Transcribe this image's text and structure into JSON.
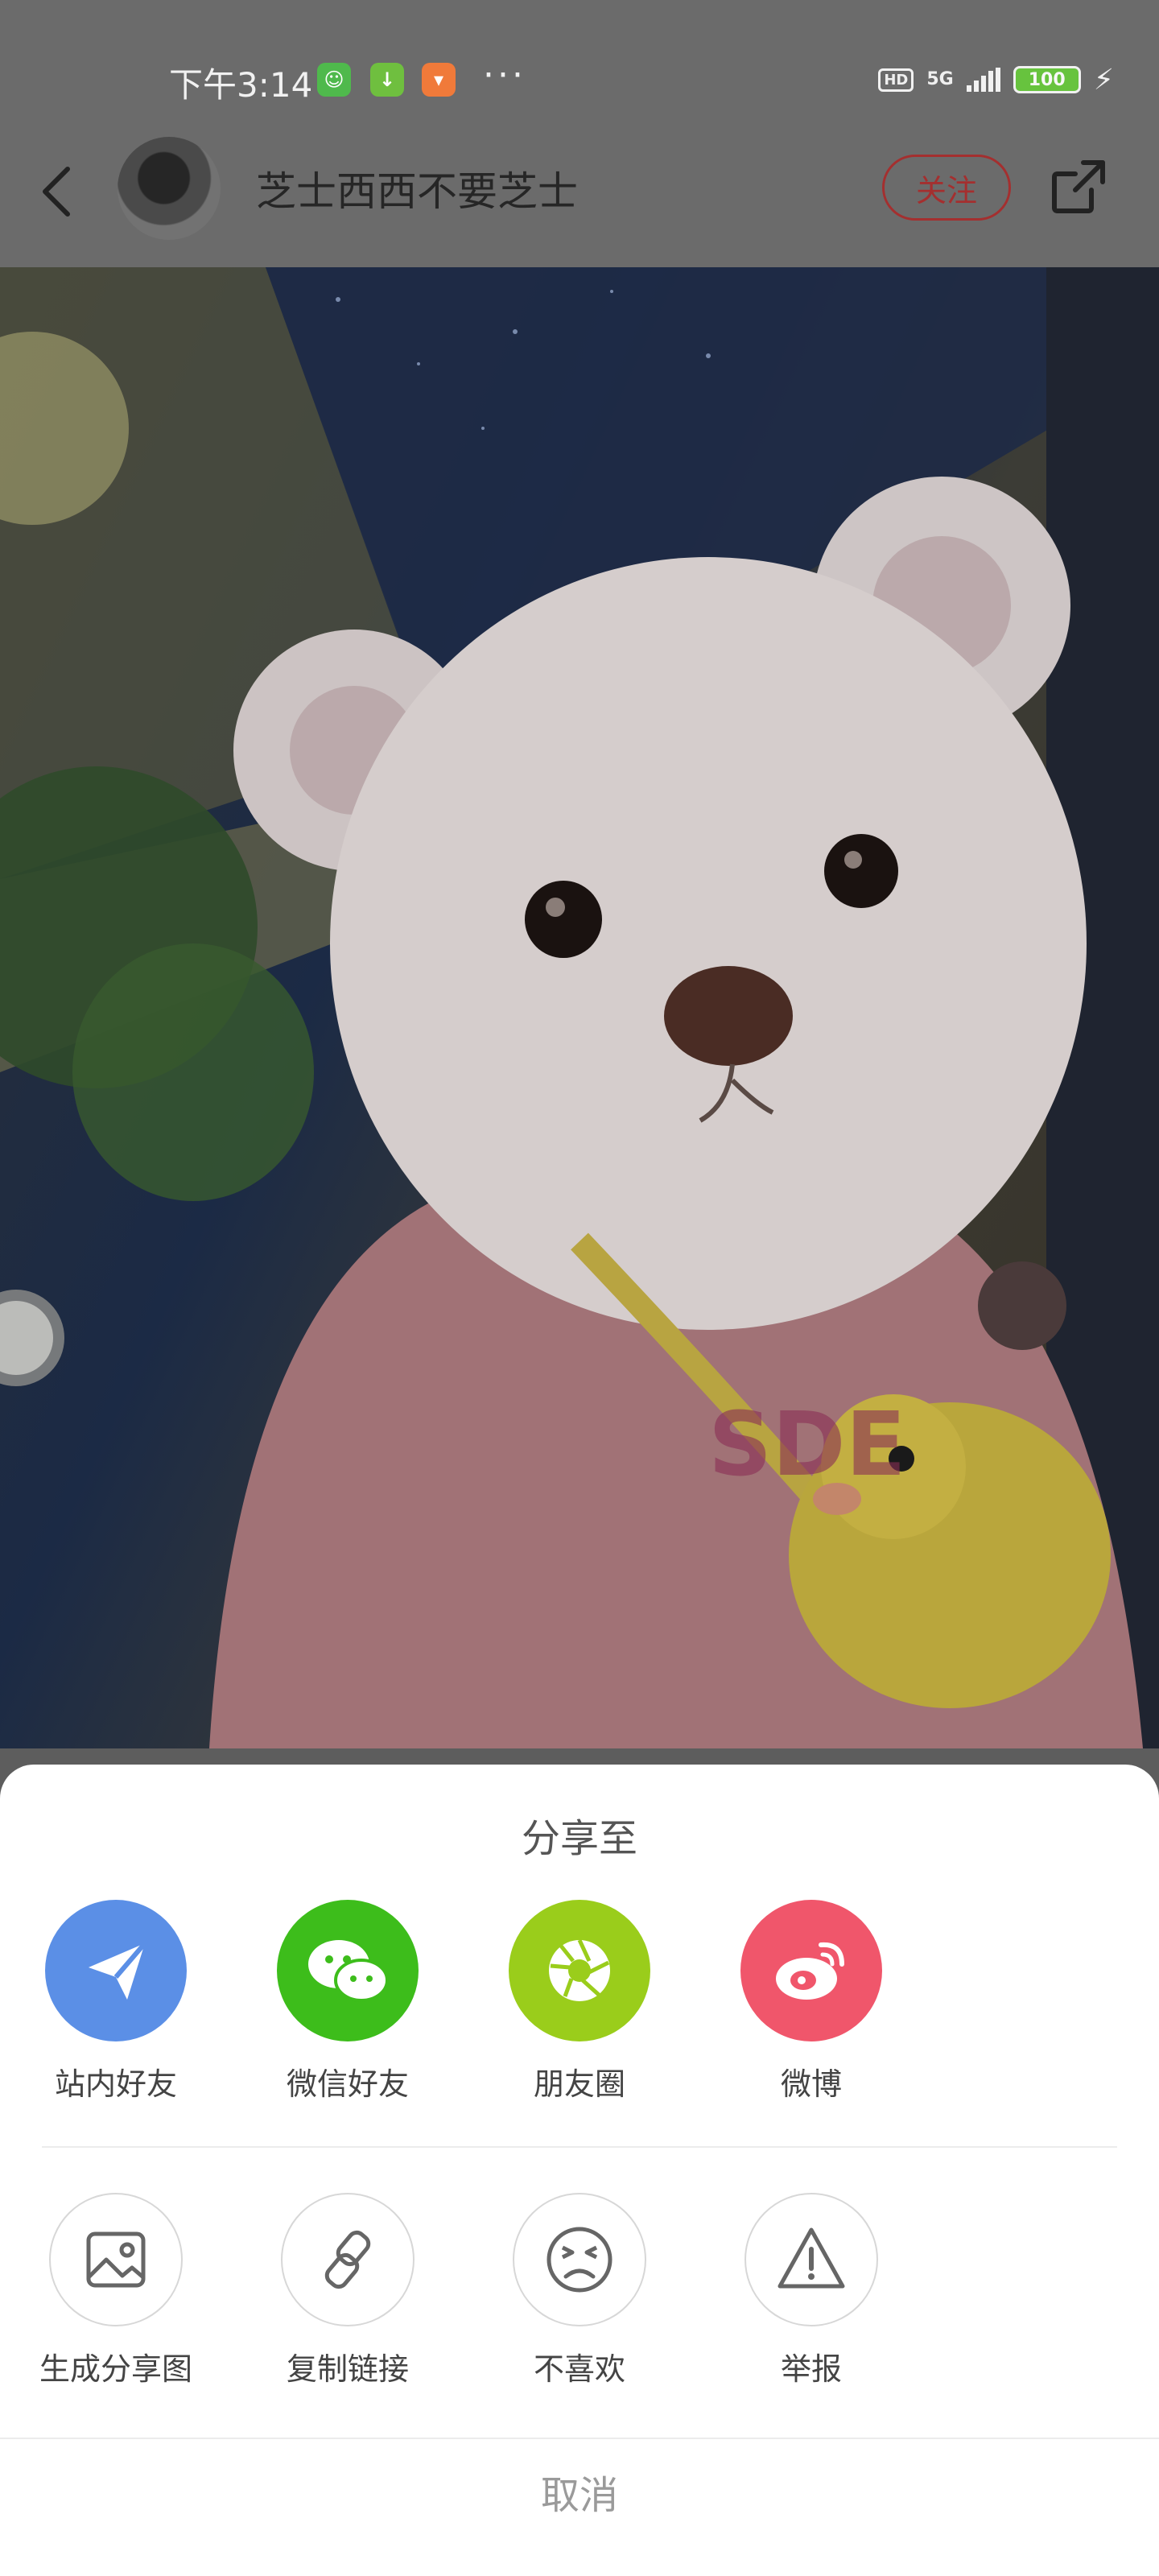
{
  "status_bar": {
    "time": "下午3:14",
    "hd": "HD",
    "network": "5G",
    "battery": "100",
    "more": "···"
  },
  "header": {
    "username": "芝士西西不要芝士",
    "follow_label": "关注"
  },
  "share_sheet": {
    "title": "分享至",
    "targets": [
      {
        "label": "站内好友",
        "icon": "paper-plane-icon",
        "color": "#5b8fe6"
      },
      {
        "label": "微信好友",
        "icon": "wechat-icon",
        "color": "#3dbd1b"
      },
      {
        "label": "朋友圈",
        "icon": "moments-icon",
        "color": "#9acd1b"
      },
      {
        "label": "微博",
        "icon": "weibo-icon",
        "color": "#f0566b"
      }
    ],
    "actions": [
      {
        "label": "生成分享图",
        "icon": "image-icon"
      },
      {
        "label": "复制链接",
        "icon": "link-icon"
      },
      {
        "label": "不喜欢",
        "icon": "unhappy-face-icon"
      },
      {
        "label": "举报",
        "icon": "warning-icon"
      }
    ],
    "cancel_label": "取消"
  }
}
